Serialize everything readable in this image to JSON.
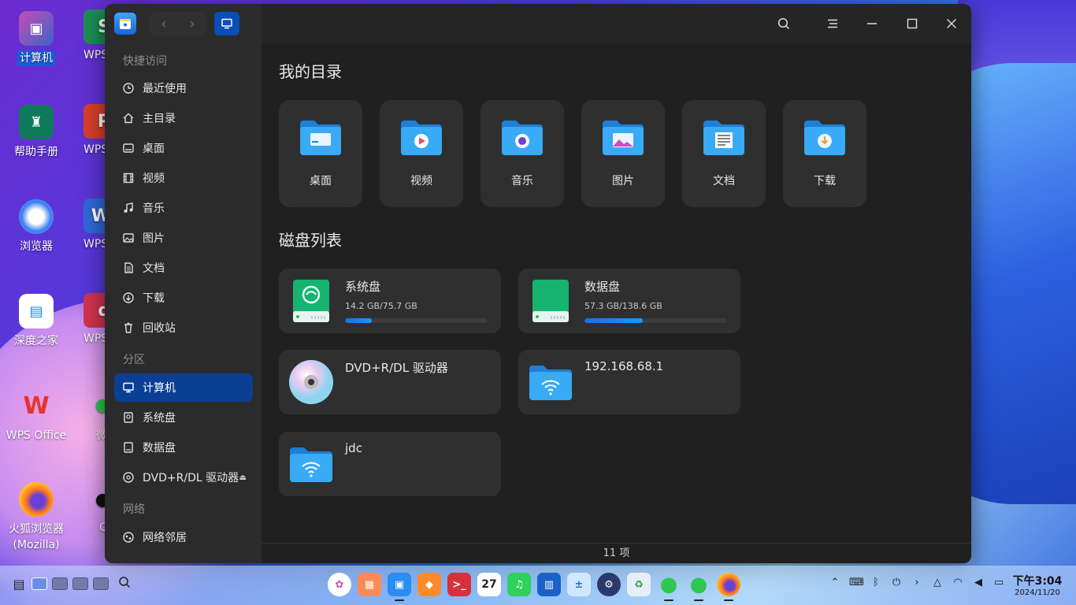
{
  "desktop": {
    "icons_col1": [
      {
        "label": "计算机",
        "selected": true
      },
      {
        "label": "帮助手册"
      },
      {
        "label": "浏览器"
      },
      {
        "label": "深度之家"
      },
      {
        "label": "WPS Office"
      },
      {
        "label": "火狐浏览器\n(Mozilla)"
      }
    ],
    "icons_col2": [
      {
        "label": "WPS"
      },
      {
        "label": "WPS"
      },
      {
        "label": "WPS"
      },
      {
        "label": "WPS"
      },
      {
        "label": "微"
      },
      {
        "label": "Q"
      }
    ]
  },
  "window": {
    "sidebar": {
      "quick_access_title": "快捷访问",
      "quick_access": [
        {
          "label": "最近使用",
          "icon": "clock-icon"
        },
        {
          "label": "主目录",
          "icon": "home-icon"
        },
        {
          "label": "桌面",
          "icon": "desktop-icon"
        },
        {
          "label": "视频",
          "icon": "film-icon"
        },
        {
          "label": "音乐",
          "icon": "music-icon"
        },
        {
          "label": "图片",
          "icon": "image-icon"
        },
        {
          "label": "文档",
          "icon": "document-icon"
        },
        {
          "label": "下载",
          "icon": "download-icon"
        },
        {
          "label": "回收站",
          "icon": "trash-icon"
        }
      ],
      "partition_title": "分区",
      "partitions": [
        {
          "label": "计算机",
          "icon": "computer-icon",
          "active": true
        },
        {
          "label": "系统盘",
          "icon": "disk-icon"
        },
        {
          "label": "数据盘",
          "icon": "disk-icon"
        },
        {
          "label": "DVD+R/DL 驱动器",
          "icon": "disc-icon",
          "eject": "⏏"
        }
      ],
      "network_title": "网络",
      "network": [
        {
          "label": "网络邻居",
          "icon": "network-icon"
        }
      ]
    },
    "main": {
      "my_dirs_title": "我的目录",
      "dirs": [
        {
          "label": "桌面",
          "icon": "desktop-folder-icon"
        },
        {
          "label": "视频",
          "icon": "video-folder-icon"
        },
        {
          "label": "音乐",
          "icon": "music-folder-icon"
        },
        {
          "label": "图片",
          "icon": "picture-folder-icon"
        },
        {
          "label": "文档",
          "icon": "document-folder-icon"
        },
        {
          "label": "下载",
          "icon": "download-folder-icon"
        }
      ],
      "disks_title": "磁盘列表",
      "disks": [
        {
          "name": "系统盘",
          "size": "14.2 GB/75.7 GB",
          "used_fraction": 0.188
        },
        {
          "name": "数据盘",
          "size": "57.3 GB/138.6 GB",
          "used_fraction": 0.413
        },
        {
          "name": "DVD+R/DL 驱动器"
        },
        {
          "name": "192.168.68.1"
        },
        {
          "name": "jdc"
        }
      ],
      "status": "11 项"
    }
  },
  "taskbar": {
    "clock_time": "下午3:04",
    "clock_date": "2024/11/20",
    "calendar_day": "27"
  },
  "colors": {
    "accent": "#0b3f94",
    "progress": "#1a6fe0",
    "folder": "#2a9bf0"
  }
}
